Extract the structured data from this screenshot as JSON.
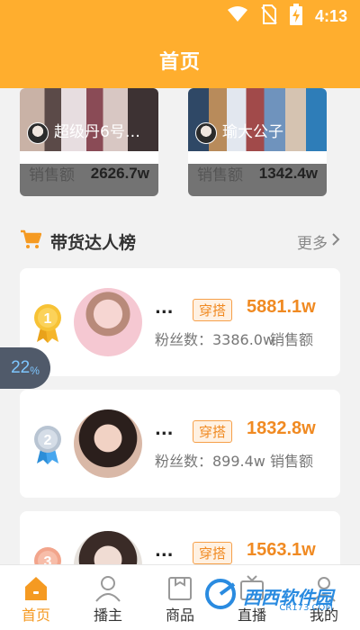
{
  "status_bar": {
    "time": "4:13",
    "icons": [
      "wifi-icon",
      "no-sim-icon",
      "battery-charging-icon"
    ]
  },
  "header": {
    "title": "首页"
  },
  "live_cards": [
    {
      "anchor_name": "超级丹6号三…",
      "sales_label": "销售额",
      "sales_value": "2626.7w"
    },
    {
      "anchor_name": "瑜大公子",
      "sales_label": "销售额",
      "sales_value": "1342.4w"
    }
  ],
  "ranking_section": {
    "title": "带货达人榜",
    "more_label": "更多",
    "icon": "cart-icon"
  },
  "ranking": [
    {
      "rank": "1",
      "name": "...",
      "tag": "穿搭",
      "amount": "5881.1w",
      "fans": "粉丝数：3386.0w",
      "sales_caption": "销售额"
    },
    {
      "rank": "2",
      "name": "...",
      "tag": "穿搭",
      "amount": "1832.8w",
      "fans": "粉丝数：899.4w",
      "sales_caption": "销售额"
    },
    {
      "rank": "3",
      "name": "...",
      "tag": "穿搭",
      "amount": "1563.1w"
    }
  ],
  "overlay": {
    "progress_value": "22",
    "progress_unit": "%"
  },
  "tabs": [
    {
      "label": "首页",
      "icon": "home-icon",
      "active": true
    },
    {
      "label": "播主",
      "icon": "user-icon",
      "active": false
    },
    {
      "label": "商品",
      "icon": "goods-icon",
      "active": false
    },
    {
      "label": "直播",
      "icon": "live-tv-icon",
      "active": false
    },
    {
      "label": "我的",
      "icon": "profile-icon",
      "active": false
    }
  ],
  "watermark": {
    "text": "西西软件园",
    "sub": "CR173.COM"
  },
  "colors": {
    "brand": "#ffae2e",
    "accent": "#f08a22"
  }
}
